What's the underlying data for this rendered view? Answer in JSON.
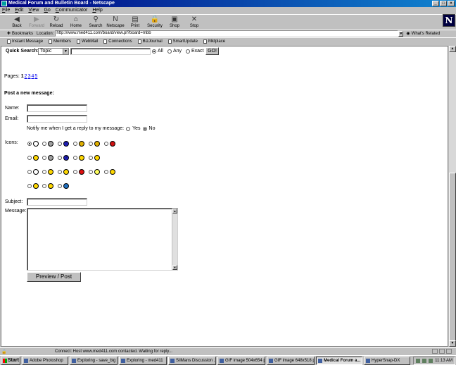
{
  "window": {
    "title": "Medical Forum and Bulletin Board - Netscape"
  },
  "menu": [
    "File",
    "Edit",
    "View",
    "Go",
    "Communicator",
    "Help"
  ],
  "toolbar": [
    {
      "label": "Back",
      "icon": "back-arrow-icon",
      "glyph": "◀",
      "enabled": true
    },
    {
      "label": "Forward",
      "icon": "forward-arrow-icon",
      "glyph": "▶",
      "enabled": false
    },
    {
      "label": "Reload",
      "icon": "reload-icon",
      "glyph": "↻",
      "enabled": true
    },
    {
      "label": "Home",
      "icon": "home-icon",
      "glyph": "⌂",
      "enabled": true
    },
    {
      "label": "Search",
      "icon": "search-icon",
      "glyph": "⚲",
      "enabled": true
    },
    {
      "label": "Netscape",
      "icon": "netscape-icon",
      "glyph": "N",
      "enabled": true
    },
    {
      "label": "Print",
      "icon": "print-icon",
      "glyph": "▤",
      "enabled": true
    },
    {
      "label": "Security",
      "icon": "lock-icon",
      "glyph": "🔒",
      "enabled": true
    },
    {
      "label": "Shop",
      "icon": "shop-icon",
      "glyph": "▣",
      "enabled": true
    },
    {
      "label": "Stop",
      "icon": "stop-icon",
      "glyph": "✕",
      "enabled": true
    }
  ],
  "location": {
    "bookmarks_label": "Bookmarks",
    "label": "Location:",
    "url": "http://www.med411.com/board/view.pl?board=mbb",
    "related_label": "What's Related"
  },
  "personal_toolbar": [
    "Instant Message",
    "Members",
    "WebMail",
    "Connections",
    "BizJournal",
    "SmartUpdate",
    "Mktplace"
  ],
  "quick_search": {
    "label": "Quick Search:",
    "select_value": "Topic",
    "options": [
      {
        "label": "All",
        "selected": true
      },
      {
        "label": "Any",
        "selected": false
      },
      {
        "label": "Exact",
        "selected": false
      }
    ],
    "go_label": "GO!"
  },
  "pages": {
    "label": "Pages:",
    "current": "1",
    "links": [
      "2",
      "3",
      "4",
      "5"
    ]
  },
  "post": {
    "title": "Post a new message:",
    "name_label": "Name:",
    "email_label": "Email:",
    "notify_label": "Notify me when I get a reply to my message:",
    "notify_yes": "Yes",
    "notify_no": "No",
    "icons_label": "Icons:",
    "subject_label": "Subject:",
    "message_label": "Message:",
    "preview_label": "Preview / Post"
  },
  "icons": [
    [
      {
        "name": "page-icon",
        "color": "#ffffff",
        "glyph": "",
        "selected": true
      },
      {
        "name": "disk-icon",
        "color": "#a0a0a0",
        "glyph": "",
        "selected": false
      },
      {
        "name": "exclamation-icon",
        "color": "#2020c0",
        "glyph": "!",
        "selected": false
      },
      {
        "name": "thumbs-up-icon",
        "color": "#e0b000",
        "glyph": "",
        "selected": false
      },
      {
        "name": "thumbs-down-icon",
        "color": "#e0b000",
        "glyph": "",
        "selected": false
      },
      {
        "name": "red-ball-icon",
        "color": "#d01010",
        "glyph": "",
        "selected": false
      }
    ],
    [
      {
        "name": "smiley-icon",
        "color": "#ffd800",
        "glyph": "",
        "selected": false
      },
      {
        "name": "hourglass-icon",
        "color": "#a0a0a0",
        "glyph": "",
        "selected": false
      },
      {
        "name": "question-icon",
        "color": "#2020c0",
        "glyph": "?",
        "selected": false
      },
      {
        "name": "warning-triangle-icon",
        "color": "#ffd800",
        "glyph": "",
        "selected": false
      },
      {
        "name": "wink-icon",
        "color": "#ffd800",
        "glyph": "",
        "selected": false
      }
    ],
    [
      {
        "name": "no-symbol-icon",
        "color": "#ffffff",
        "glyph": "",
        "selected": false
      },
      {
        "name": "grin-icon",
        "color": "#ffd800",
        "glyph": "",
        "selected": false
      },
      {
        "name": "frown-icon",
        "color": "#ffd800",
        "glyph": "",
        "selected": false
      },
      {
        "name": "heart-icon",
        "color": "#e01010",
        "glyph": "",
        "selected": false
      },
      {
        "name": "lightbulb-icon",
        "color": "#ffff60",
        "glyph": "",
        "selected": false
      },
      {
        "name": "surprised-icon",
        "color": "#ffd800",
        "glyph": "",
        "selected": false
      }
    ],
    [
      {
        "name": "in-love-icon",
        "color": "#ffd800",
        "glyph": "",
        "selected": false
      },
      {
        "name": "cool-icon",
        "color": "#ffd800",
        "glyph": "",
        "selected": false
      },
      {
        "name": "globe-icon",
        "color": "#2070c0",
        "glyph": "",
        "selected": false
      }
    ]
  ],
  "status": {
    "text": "Connect: Host www.med411.com contacted. Waiting for reply..."
  },
  "taskbar": {
    "start_label": "Start",
    "tasks": [
      {
        "label": "Adobe Photoshop",
        "active": false
      },
      {
        "label": "Exploring - save_big",
        "active": false
      },
      {
        "label": "Exploring - med411",
        "active": false
      },
      {
        "label": "SilMans Discussion ...",
        "active": false
      },
      {
        "label": "GIF image 504x654 p...",
        "active": false
      },
      {
        "label": "GIF image 648x518 p...",
        "active": false
      },
      {
        "label": "Medical Forum a...",
        "active": true
      },
      {
        "label": "HyperSnap-DX",
        "active": false
      }
    ],
    "clock": "11:13 AM"
  }
}
